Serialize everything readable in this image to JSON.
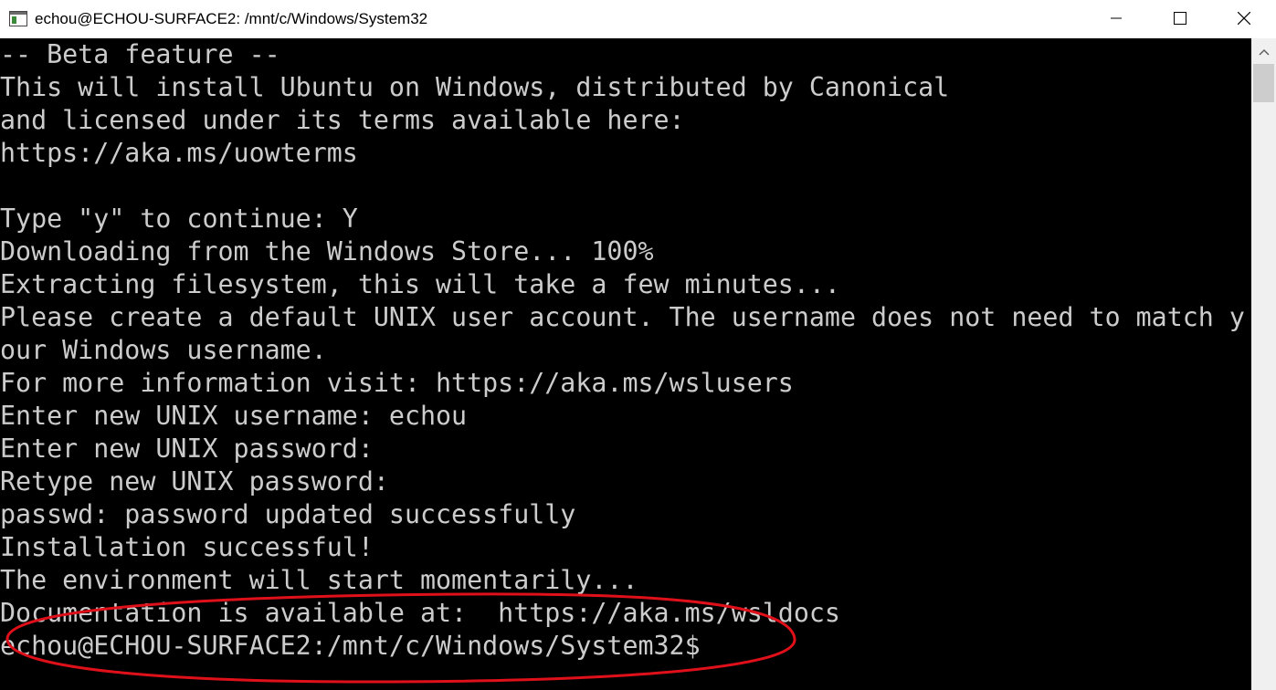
{
  "window": {
    "title": "echou@ECHOU-SURFACE2: /mnt/c/Windows/System32",
    "icons": {
      "app": "console-window-icon",
      "minimize": "minimize-icon",
      "maximize": "maximize-icon",
      "close": "close-icon",
      "scroll_up": "scroll-up-arrow-icon"
    }
  },
  "terminal": {
    "background_color": "#000000",
    "text_color": "#cccccc",
    "lines": [
      "-- Beta feature --",
      "This will install Ubuntu on Windows, distributed by Canonical",
      "and licensed under its terms available here:",
      "https://aka.ms/uowterms",
      "",
      "Type \"y\" to continue: Y",
      "Downloading from the Windows Store... 100%",
      "Extracting filesystem, this will take a few minutes...",
      "Please create a default UNIX user account. The username does not need to match y",
      "our Windows username.",
      "For more information visit: https://aka.ms/wslusers",
      "Enter new UNIX username: echou",
      "Enter new UNIX password:",
      "Retype new UNIX password:",
      "passwd: password updated successfully",
      "Installation successful!",
      "The environment will start momentarily...",
      "Documentation is available at:  https://aka.ms/wsldocs",
      "echou@ECHOU-SURFACE2:/mnt/c/Windows/System32$"
    ]
  },
  "annotation": {
    "shape": "ellipse",
    "color": "#e0101a",
    "target": "prompt-line"
  }
}
